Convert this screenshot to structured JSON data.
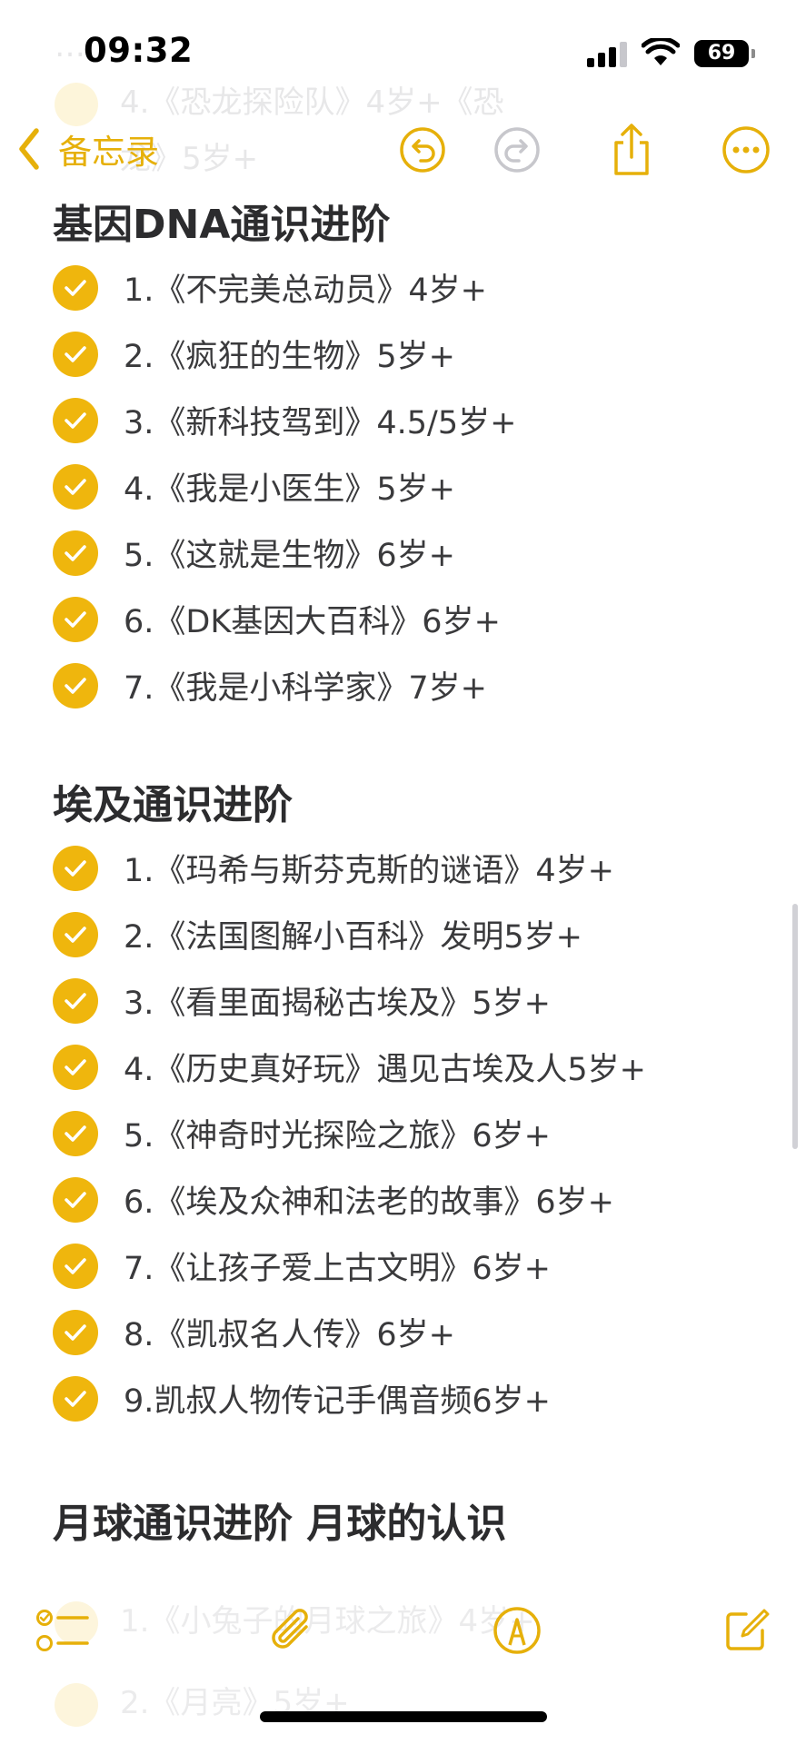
{
  "status_bar": {
    "time": "09:32",
    "battery": "69"
  },
  "nav": {
    "back_label": "备忘录"
  },
  "colors": {
    "accent": "#e6b00a",
    "check": "#efb60d"
  },
  "ghost_top": {
    "line1": "…",
    "line2": "4.《恐龙探险队》4岁+《恐",
    "line3": "龙》5岁+"
  },
  "sections": [
    {
      "title": "基因DNA通识进阶",
      "items": [
        "1.《不完美总动员》4岁+",
        "2.《疯狂的生物》5岁+",
        "3.《新科技驾到》4.5/5岁+",
        "4.《我是小医生》5岁+",
        "5.《这就是生物》6岁+",
        "6.《DK基因大百科》6岁+",
        "7.《我是小科学家》7岁+"
      ]
    },
    {
      "title": "埃及通识进阶",
      "items": [
        "1.《玛希与斯芬克斯的谜语》4岁+",
        "2.《法国图解小百科》发明5岁+",
        "3.《看里面揭秘古埃及》5岁+",
        "4.《历史真好玩》遇见古埃及人5岁+",
        "5.《神奇时光探险之旅》6岁+",
        "6.《埃及众神和法老的故事》6岁+",
        "7.《让孩子爱上古文明》6岁+",
        "8.《凯叔名人传》6岁+",
        "9.凯叔人物传记手偶音频6岁+"
      ]
    },
    {
      "title": "月球通识进阶 月球的认识",
      "items": []
    }
  ],
  "ghost_bottom": {
    "line1": "1.《小兔子的月球之旅》4岁+",
    "line2": "2.《月亮》5岁+"
  }
}
